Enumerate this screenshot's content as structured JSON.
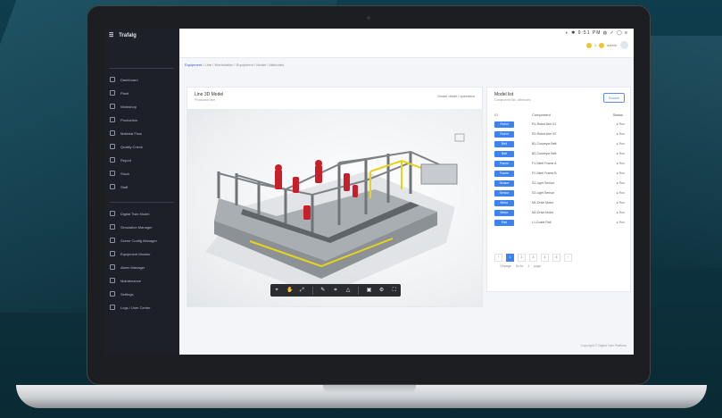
{
  "app": {
    "brand": "Trafalg",
    "menu_glyph": "☰"
  },
  "status_bar": {
    "indicators": "◐ ✱ 9:51 PM ◍ ✓ ◯ ≡"
  },
  "user": {
    "label1": "1",
    "label2": "admin"
  },
  "breadcrumb": {
    "current": "Equipment",
    "rest": "/ Line / Workstation / Equipment / Model / Attributes"
  },
  "sidebar": {
    "items_top": [
      {
        "label": "Dashboard"
      },
      {
        "label": "Plant"
      },
      {
        "label": "Workshop"
      },
      {
        "label": "Production"
      },
      {
        "label": "Material Flow"
      },
      {
        "label": "Quality Check"
      },
      {
        "label": "Report"
      },
      {
        "label": "Stock"
      },
      {
        "label": "Staff"
      }
    ],
    "items_bottom": [
      {
        "label": "Digital Twin Model"
      },
      {
        "label": "Simulation Manager"
      },
      {
        "label": "Scene Config Manager"
      },
      {
        "label": "Equipment Monitor"
      },
      {
        "label": "Alarm Manager"
      },
      {
        "label": "Maintenance"
      },
      {
        "label": "Settings"
      },
      {
        "label": "Logs / User Center"
      }
    ]
  },
  "viewer": {
    "title": "Line 3D Model",
    "subtitle": "Production line",
    "link": "Model detail / operation"
  },
  "panel": {
    "title": "Model list",
    "subtitle": "Component list / attributes",
    "search_label": "Search",
    "col_id": "ID",
    "col_name": "Component",
    "col_status": "Status",
    "rows": [
      {
        "tag": "Robot",
        "name": "R1-Robot Arm 01",
        "status": "● Run"
      },
      {
        "tag": "Robot",
        "name": "R2-Robot Arm 02",
        "status": "● Run"
      },
      {
        "tag": "Belt",
        "name": "B1-Conveyor Belt",
        "status": "● Run"
      },
      {
        "tag": "Belt",
        "name": "B2-Conveyor Belt",
        "status": "● Run"
      },
      {
        "tag": "Frame",
        "name": "F1-Steel Frame A",
        "status": "● Run"
      },
      {
        "tag": "Frame",
        "name": "F2-Steel Frame B",
        "status": "● Run"
      },
      {
        "tag": "Sensor",
        "name": "S1-Light Sensor",
        "status": "● Run"
      },
      {
        "tag": "Sensor",
        "name": "S2-Light Sensor",
        "status": "● Run"
      },
      {
        "tag": "Motor",
        "name": "M1-Drive Motor",
        "status": "● Run"
      },
      {
        "tag": "Motor",
        "name": "M2-Drive Motor",
        "status": "● Run"
      },
      {
        "tag": "Rail",
        "name": "L1-Guide Rail",
        "status": "● Run"
      }
    ],
    "pages": [
      "‹",
      "1",
      "2",
      "3",
      "4",
      "5",
      "›"
    ],
    "pager_meta": [
      "10/page",
      "Go to",
      "1",
      "page"
    ]
  },
  "footer": {
    "text": "Copyright © Digital Twin Platform"
  },
  "colors": {
    "accent": "#3c82f0",
    "sidebar_bg": "#1e2029",
    "robot_red": "#c8202a",
    "safety_yellow": "#e8d21a"
  }
}
